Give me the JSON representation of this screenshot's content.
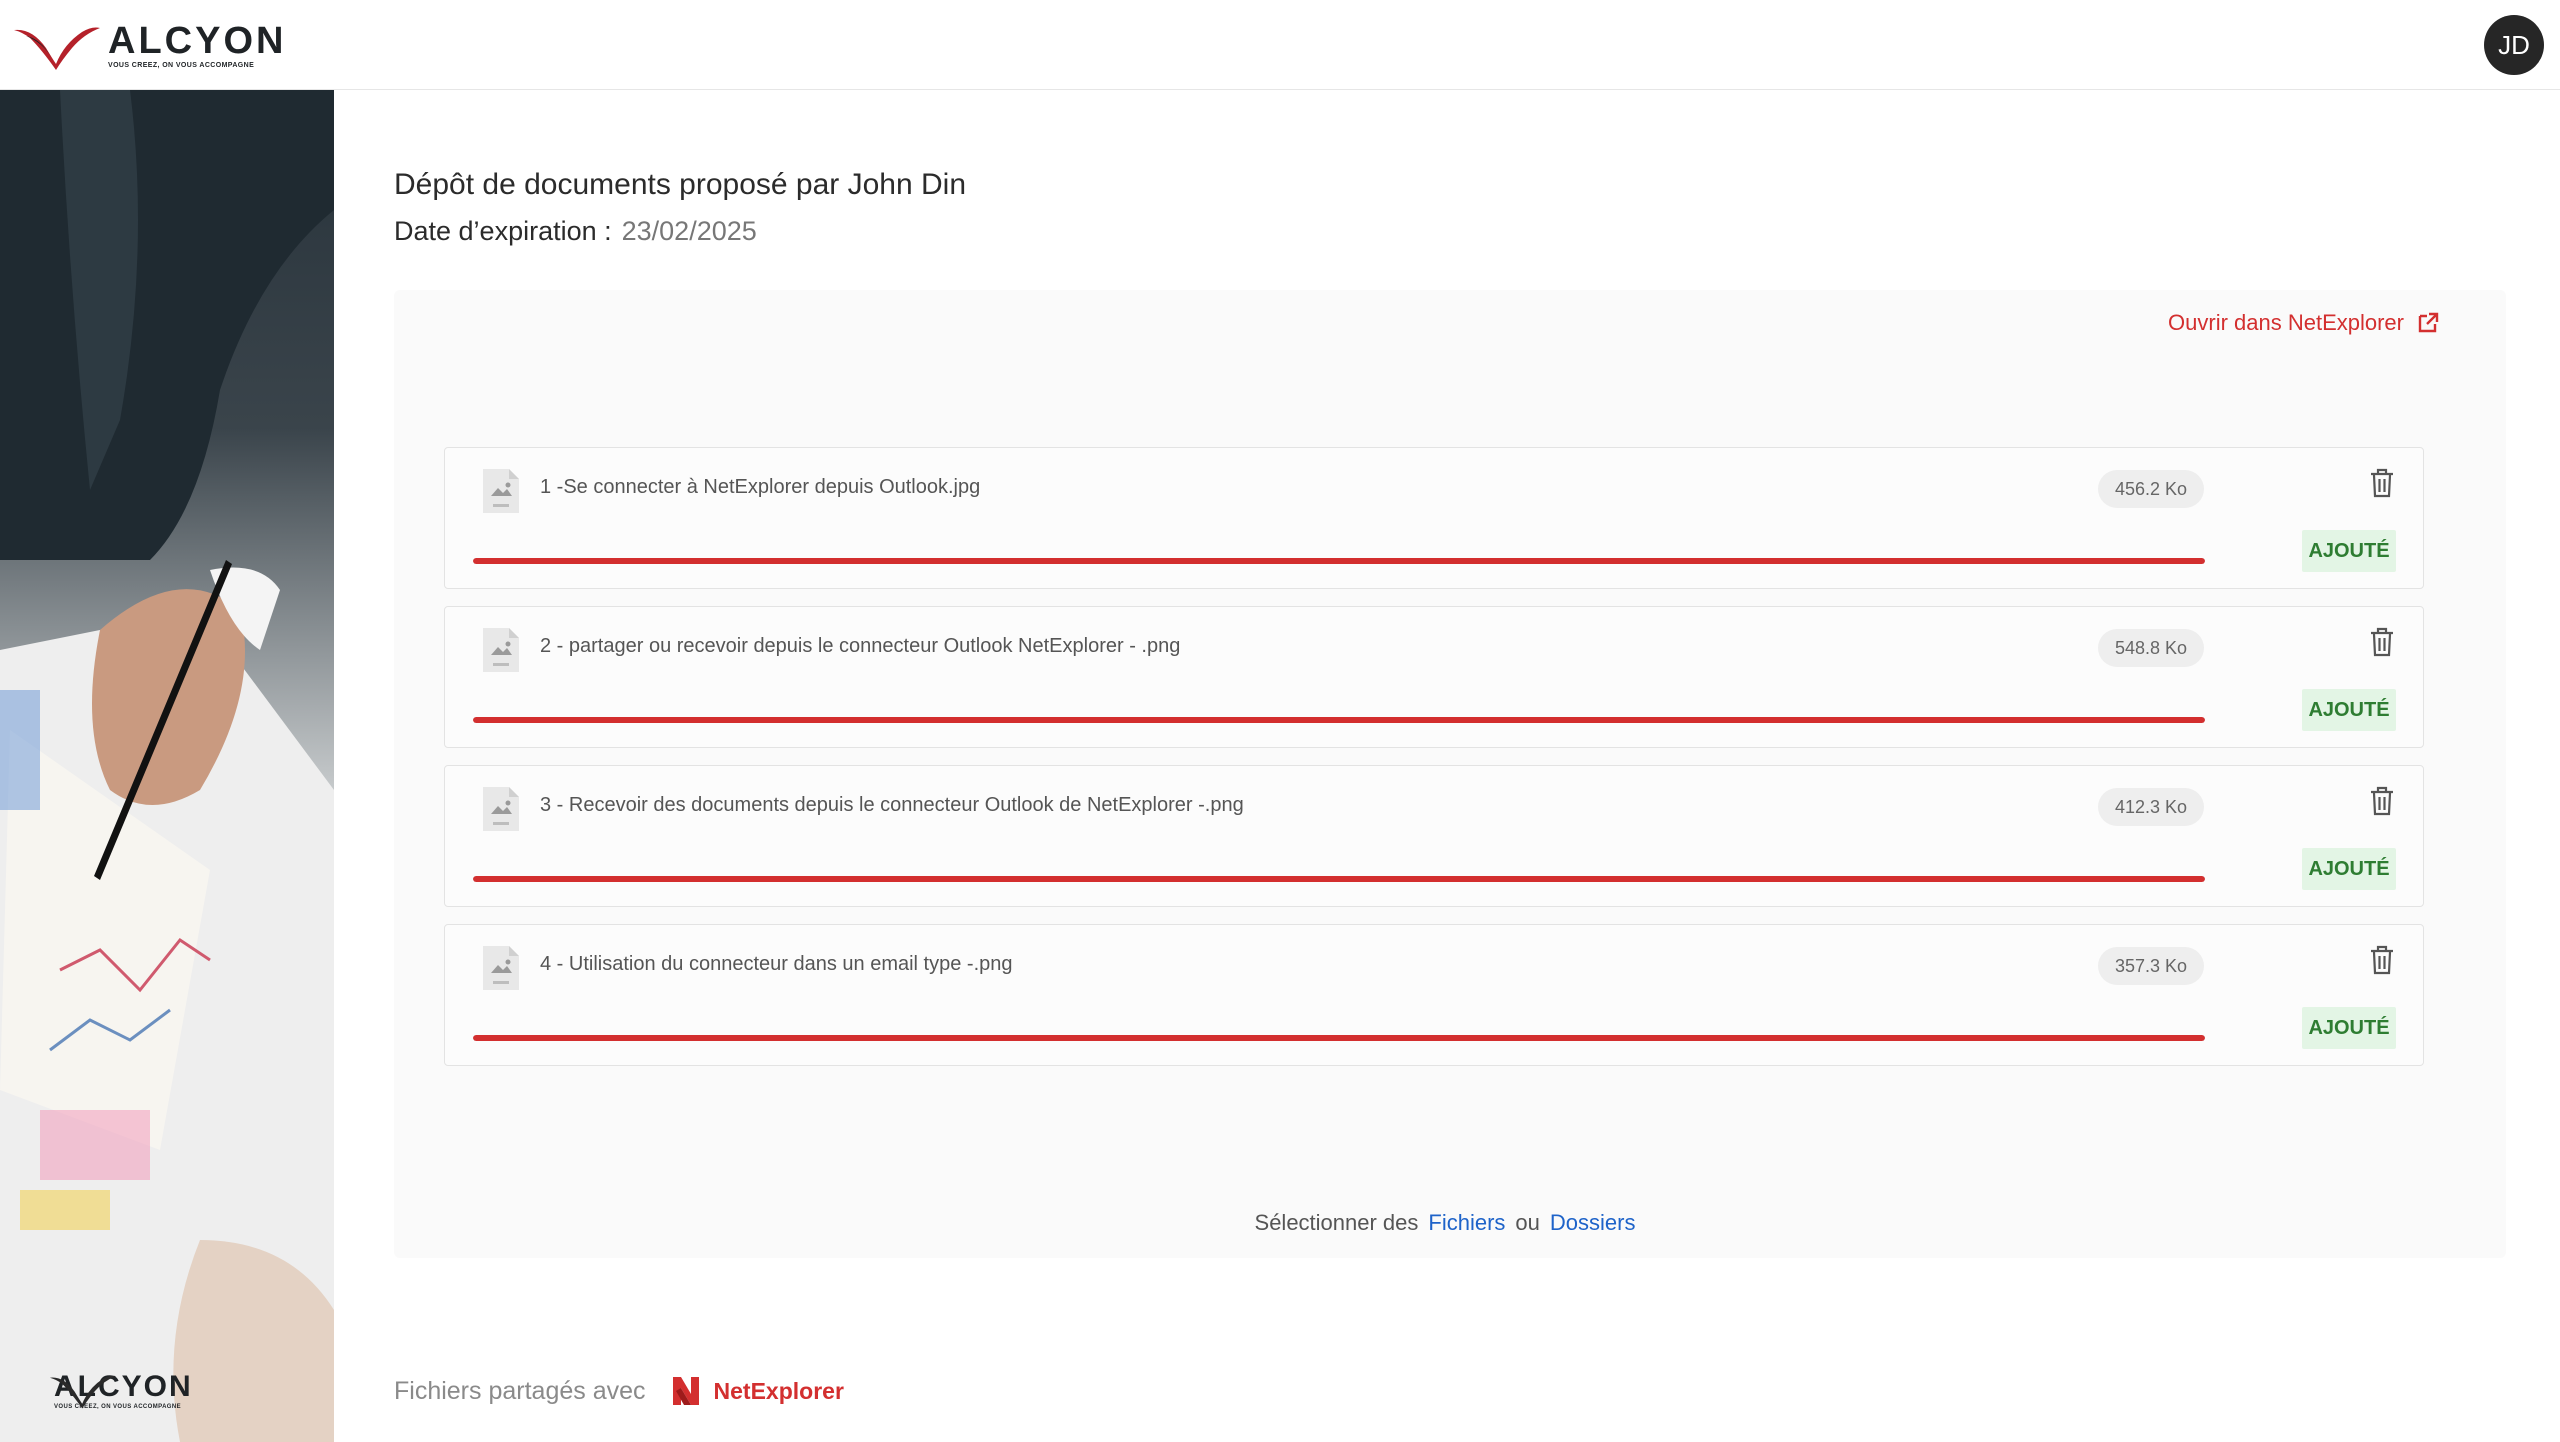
{
  "header": {
    "brand": "ALCYON",
    "tagline": "VOUS CREEZ, ON VOUS ACCOMPAGNE",
    "avatar_initials": "JD"
  },
  "side": {
    "brand": "ALCYON",
    "tagline": "VOUS CREEZ, ON VOUS ACCOMPAGNE"
  },
  "main": {
    "title": "Dépôt de documents proposé par John Din",
    "expiry_label": "Date d’expiration :",
    "expiry_value": "23/02/2025",
    "open_link": "Ouvrir dans NetExplorer",
    "files": [
      {
        "name": "1 -Se connecter à NetExplorer depuis Outlook.jpg",
        "size": "456.2 Ko",
        "status": "AJOUTÉ",
        "progress": 1.0,
        "icon": "image-file-icon"
      },
      {
        "name": "2 - partager ou recevoir depuis le connecteur Outlook NetExplorer - .png",
        "size": "548.8 Ko",
        "status": "AJOUTÉ",
        "progress": 1.0,
        "icon": "image-file-icon"
      },
      {
        "name": "3 - Recevoir des documents depuis le connecteur Outlook de NetExplorer -.png",
        "size": "412.3 Ko",
        "status": "AJOUTÉ",
        "progress": 1.0,
        "icon": "image-file-icon"
      },
      {
        "name": "4 - Utilisation du connecteur dans un email type -.png",
        "size": "357.3 Ko",
        "status": "AJOUTÉ",
        "progress": 1.0,
        "icon": "image-file-icon"
      }
    ],
    "select_prefix": "Sélectionner des",
    "select_files": "Fichiers",
    "select_or": "ou",
    "select_folders": "Dossiers"
  },
  "footer": {
    "shared_with": "Fichiers partagés avec",
    "provider": "NetExplorer"
  },
  "colors": {
    "accent": "#d32f2f",
    "link": "#1e63c9",
    "success_bg": "#e3f5e5",
    "success_text": "#2e7d32"
  }
}
